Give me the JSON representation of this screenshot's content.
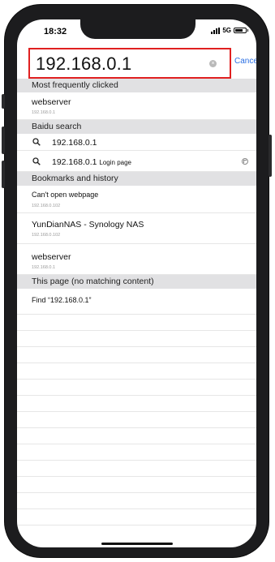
{
  "status": {
    "time": "18:32",
    "network": "5G"
  },
  "address_bar": {
    "url": "192.168.0.1",
    "cancel_label": "Cancel"
  },
  "sections": {
    "frequent": {
      "header": "Most frequently clicked",
      "items": [
        {
          "title": "webserver",
          "sub": "192.168.0.1"
        }
      ]
    },
    "baidu": {
      "header": "Baidu search",
      "items": [
        {
          "query": "192.168.0.1",
          "suffix": ""
        },
        {
          "query": "192.168.0.1",
          "suffix": "Login page"
        }
      ]
    },
    "bookmarks": {
      "header": "Bookmarks and history",
      "items": [
        {
          "title": "Can't open webpage",
          "sub": "192.168.0.102"
        },
        {
          "title": "YunDianNAS - Synology NAS",
          "sub": "192.168.0.102"
        },
        {
          "title": "webserver",
          "sub": "192.168.0.1"
        }
      ]
    },
    "this_page": {
      "header": "This page (no matching content)",
      "find_label": "Find “192.168.0.1”"
    }
  },
  "icons": {
    "clear": "clear-icon",
    "search": "magnifier-icon",
    "fill": "arrow-up-left-icon"
  },
  "colors": {
    "highlight": "#e02020",
    "link": "#2a6fe3",
    "section_bg": "#e1e1e3"
  }
}
